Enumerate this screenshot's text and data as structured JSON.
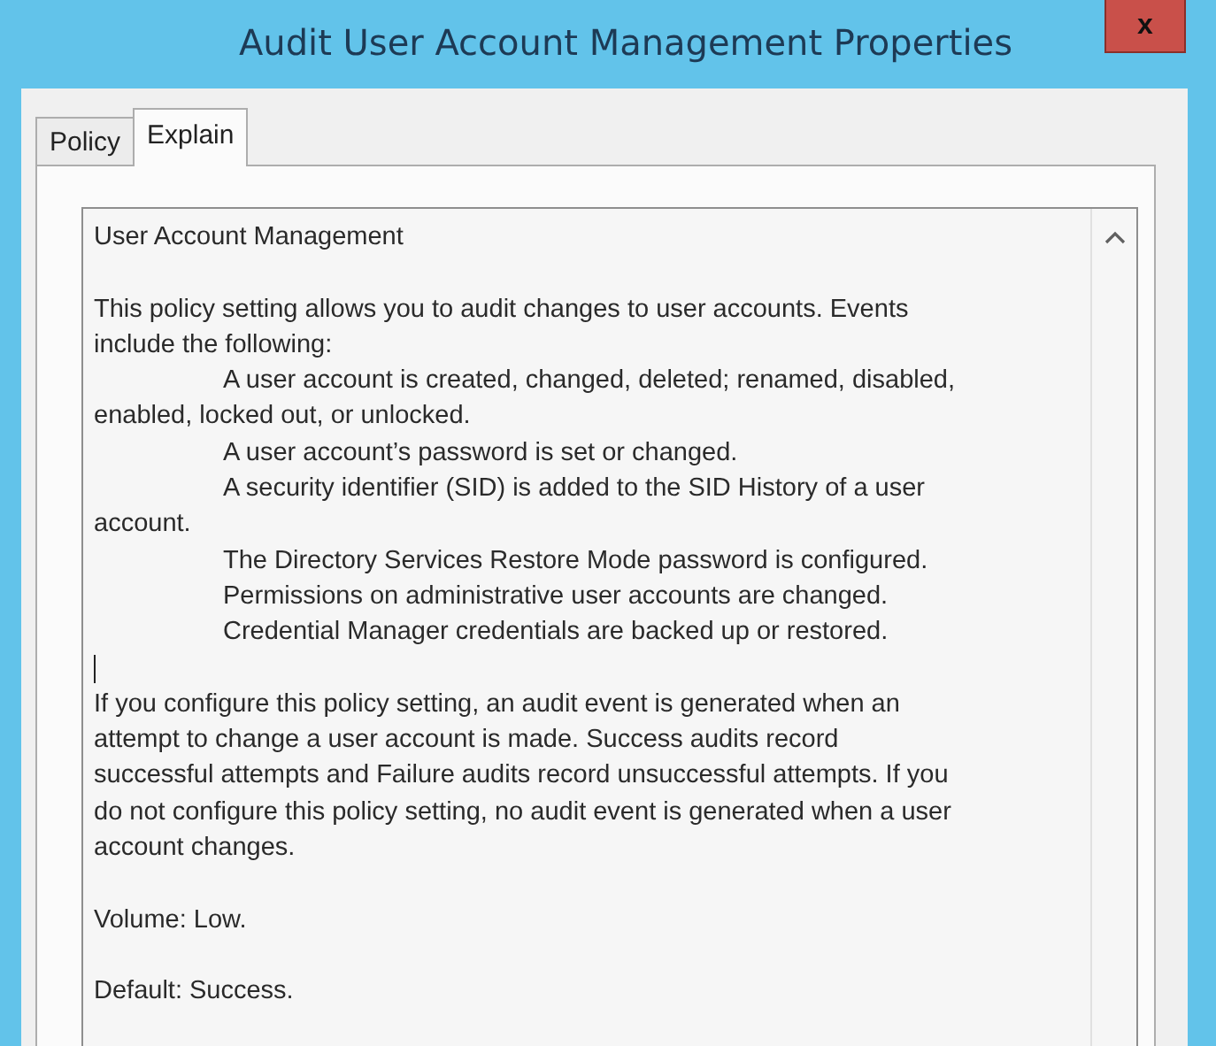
{
  "window": {
    "title": "Audit User Account Management Properties",
    "close": "x"
  },
  "tabs": [
    {
      "label": "Policy",
      "selected": false
    },
    {
      "label": "Explain",
      "selected": true
    }
  ],
  "explain": {
    "paragraphs": [
      {
        "lines": [
          {
            "text": "User Account Management",
            "indented": false
          }
        ]
      },
      {
        "cursor_before": false,
        "lines": [
          {
            "text": "This policy setting allows you to audit changes to user accounts. Events",
            "indented": false
          },
          {
            "text": "include the following:",
            "indented": false
          },
          {
            "text": "A user account is created, changed, deleted; renamed, disabled,",
            "indented": true
          },
          {
            "text": "enabled, locked out, or unlocked.",
            "indented": false
          },
          {
            "text": "A user account’s password is set or changed.",
            "indented": true
          },
          {
            "text": "A security identifier (SID) is added to the SID History of a user",
            "indented": true
          },
          {
            "text": "account.",
            "indented": false
          },
          {
            "text": "The Directory Services Restore Mode password is configured.",
            "indented": true
          },
          {
            "text": "Permissions on administrative user accounts are changed.",
            "indented": true
          },
          {
            "text": "Credential Manager credentials are backed up or restored.",
            "indented": true
          }
        ]
      },
      {
        "cursor_before": true,
        "lines": [
          {
            "text": "If you configure this policy setting, an audit event is generated when an",
            "indented": false
          },
          {
            "text": "attempt to change a user account is made. Success audits record",
            "indented": false
          },
          {
            "text": "successful attempts and Failure audits record unsuccessful attempts. If you",
            "indented": false
          },
          {
            "text": "do not configure this policy setting, no audit event is generated when a user",
            "indented": false
          },
          {
            "text": "account changes.",
            "indented": false
          }
        ]
      },
      {
        "cursor_before": false,
        "lines": [
          {
            "text": "Volume: Low.",
            "indented": false
          }
        ]
      },
      {
        "cursor_before": false,
        "lines": [
          {
            "text": "Default: Success.",
            "indented": false
          }
        ]
      }
    ]
  }
}
